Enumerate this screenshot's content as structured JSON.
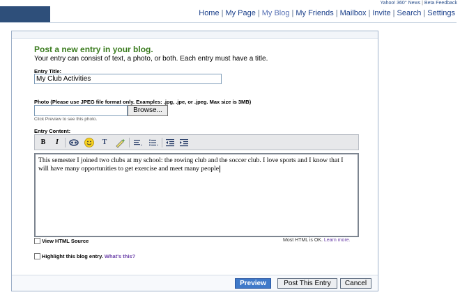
{
  "top_links": {
    "items": [
      "Yahoo! 360° News",
      "Beta Feedback"
    ]
  },
  "nav": {
    "items": [
      {
        "label": "Home",
        "active": false
      },
      {
        "label": "My Page",
        "active": false
      },
      {
        "label": "My Blog",
        "active": true
      },
      {
        "label": "My Friends",
        "active": false
      },
      {
        "label": "Mailbox",
        "active": false
      },
      {
        "label": "Invite",
        "active": false
      },
      {
        "label": "Search",
        "active": false
      },
      {
        "label": "Settings",
        "active": false
      }
    ],
    "separator": "|"
  },
  "form": {
    "heading": "Post a new entry in your blog.",
    "subheading": "Your entry can consist of text, a photo, or both. Each entry must have a title.",
    "title_label": "Entry Title:",
    "title_value": "My Club Activities",
    "photo_label": "Photo (Please use JPEG file format only. Examples: .jpg, .jpe, or .jpeg. Max size is 3MB)",
    "photo_value": "",
    "browse_label": "Browse...",
    "photo_hint": "Click Preview to see this photo.",
    "content_label": "Entry Content:",
    "content_text": "This semester I joined two clubs at my school: the rowing club and the soccer club.  I love sports and I know that I will have many opportunities to get exercise and meet many people",
    "view_html_label": "View HTML Source",
    "html_note": "Most HTML is OK.",
    "learn_more": "Learn more.",
    "highlight_label": "Highlight this blog entry.",
    "whats_this": "What's this?"
  },
  "toolbar": {
    "bold": "B",
    "italic": "I",
    "link_icon": "🔗",
    "emoticon": "☺",
    "text_color": "T",
    "highlight": "✎",
    "align": "≡",
    "list": "☰",
    "outdent": "⇤",
    "indent": "⇥"
  },
  "buttons": {
    "preview": "Preview",
    "post": "Post This Entry",
    "cancel": "Cancel"
  },
  "colors": {
    "nav_block": "#2e4f7a",
    "heading": "#3a7b1e",
    "link": "#1a3f8a",
    "preview_button": "#3f79c9"
  }
}
